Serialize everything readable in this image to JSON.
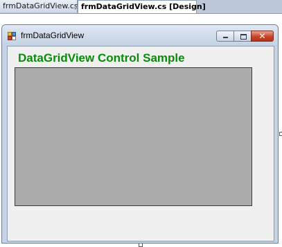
{
  "tabs": [
    {
      "label": "frmDataGridView.cs",
      "active": false
    },
    {
      "label": "frmDataGridView.cs [Design]",
      "active": true
    }
  ],
  "form": {
    "title": "frmDataGridView",
    "icon": "form-app-icon",
    "caption_buttons": {
      "minimize": "minimize-icon",
      "maximize": "maximize-icon",
      "close": "close-icon",
      "close_glyph": "✕"
    },
    "heading": "DataGridView Control Sample",
    "heading_color": "#0a8a0a",
    "grid_background": "#ababab"
  }
}
